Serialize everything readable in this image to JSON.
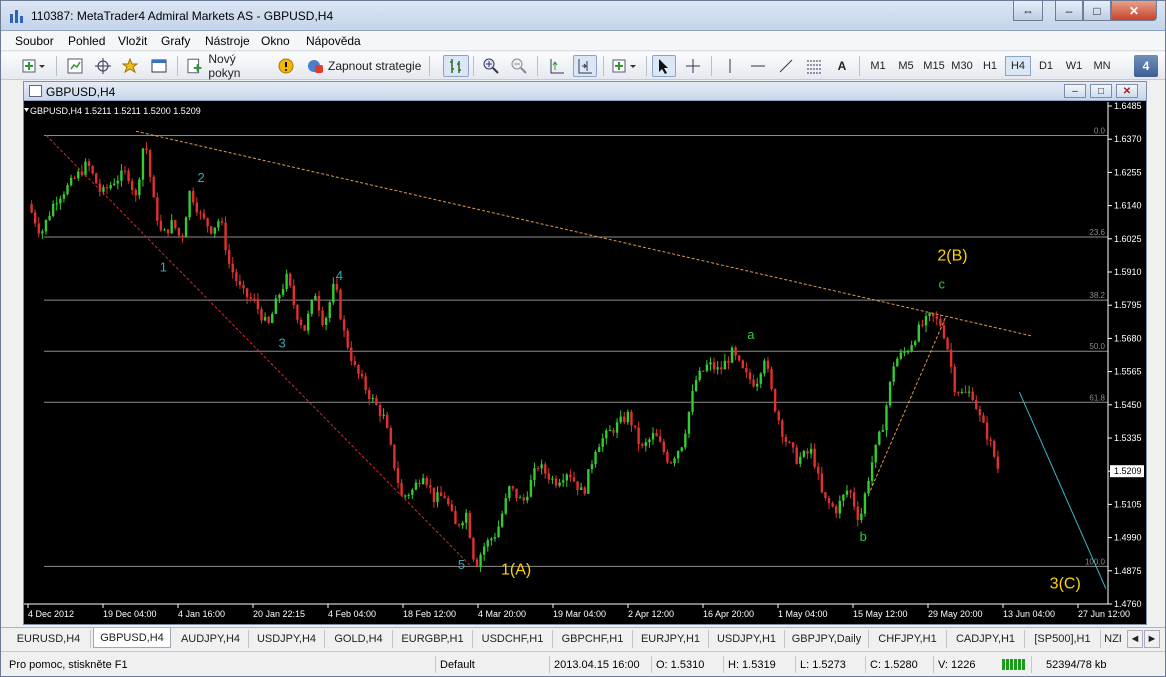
{
  "window": {
    "title": "110387: MetaTrader4 Admiral Markets AS - GBPUSD,H4",
    "buttons": {
      "restore": "⇔",
      "minimize": "–",
      "maximize": "□",
      "close": "✕"
    }
  },
  "menu": [
    "Soubor",
    "Pohled",
    "Vložit",
    "Grafy",
    "Nástroje",
    "Okno",
    "Nápověda"
  ],
  "toolbar": {
    "new_order_label": "Nový pokyn",
    "strategy_label": "Zapnout strategie",
    "text_tool_label": "A",
    "timeframes": [
      "M1",
      "M5",
      "M15",
      "M30",
      "H1",
      "H4",
      "D1",
      "W1",
      "MN"
    ],
    "active_timeframe": "H4",
    "window_count": "4"
  },
  "chart_window": {
    "title": "GBPUSD,H4",
    "header": "GBPUSD,H4  1.5211 1.5211 1.5200 1.5209"
  },
  "chart_data": {
    "type": "candlestick",
    "symbol": "GBPUSD",
    "timeframe": "H4",
    "ohlc_readout": [
      1.5211,
      1.5211,
      1.52,
      1.5209
    ],
    "current_price": "1.5209",
    "ylim": [
      1.471,
      1.6485
    ],
    "y_ticks": [
      "1.6485",
      "1.6370",
      "1.6255",
      "1.6140",
      "1.6025",
      "1.5910",
      "1.5795",
      "1.5680",
      "1.5565",
      "1.5450",
      "1.5335",
      "1.5209",
      "1.5105",
      "1.4990",
      "1.4875",
      "1.4760"
    ],
    "x_ticks": [
      "4 Dec 2012",
      "19 Dec 04:00",
      "4 Jan 16:00",
      "20 Jan 22:15",
      "4 Feb 04:00",
      "18 Feb 12:00",
      "4 Mar 20:00",
      "19 Mar 04:00",
      "2 Apr 12:00",
      "16 Apr 20:00",
      "1 May 04:00",
      "15 May 12:00",
      "29 May 20:00",
      "13 Jun 04:00",
      "27 Jun 12:00"
    ],
    "fibonacci": [
      {
        "label": "0.0",
        "price": 1.638
      },
      {
        "label": "23.6",
        "price": 1.6018
      },
      {
        "label": "38.2",
        "price": 1.5793
      },
      {
        "label": "50.0",
        "price": 1.5611
      },
      {
        "label": "61.8",
        "price": 1.5429
      },
      {
        "label": "100.0",
        "price": 1.4844
      }
    ],
    "price_path": [
      [
        0,
        1.6135
      ],
      [
        0.012,
        1.603
      ],
      [
        0.025,
        1.615
      ],
      [
        0.04,
        1.621
      ],
      [
        0.055,
        1.628
      ],
      [
        0.068,
        1.617
      ],
      [
        0.08,
        1.622
      ],
      [
        0.092,
        1.625
      ],
      [
        0.1,
        1.6155
      ],
      [
        0.108,
        1.638
      ],
      [
        0.116,
        1.615
      ],
      [
        0.124,
        1.602
      ],
      [
        0.134,
        1.607
      ],
      [
        0.142,
        1.6005
      ],
      [
        0.15,
        1.6185
      ],
      [
        0.16,
        1.609
      ],
      [
        0.17,
        1.6045
      ],
      [
        0.178,
        1.6085
      ],
      [
        0.186,
        1.5925
      ],
      [
        0.198,
        1.582
      ],
      [
        0.21,
        1.5785
      ],
      [
        0.222,
        1.5695
      ],
      [
        0.232,
        1.581
      ],
      [
        0.24,
        1.5875
      ],
      [
        0.248,
        1.575
      ],
      [
        0.256,
        1.569
      ],
      [
        0.266,
        1.582
      ],
      [
        0.274,
        1.5705
      ],
      [
        0.284,
        1.5855
      ],
      [
        0.292,
        1.5685
      ],
      [
        0.302,
        1.5555
      ],
      [
        0.316,
        1.5455
      ],
      [
        0.33,
        1.537
      ],
      [
        0.338,
        1.5225
      ],
      [
        0.346,
        1.509
      ],
      [
        0.356,
        1.5115
      ],
      [
        0.366,
        1.518
      ],
      [
        0.376,
        1.5085
      ],
      [
        0.386,
        1.5095
      ],
      [
        0.396,
        1.4985
      ],
      [
        0.406,
        1.5035
      ],
      [
        0.414,
        1.4845
      ],
      [
        0.422,
        1.4915
      ],
      [
        0.434,
        1.4965
      ],
      [
        0.446,
        1.5125
      ],
      [
        0.458,
        1.507
      ],
      [
        0.472,
        1.5205
      ],
      [
        0.488,
        1.5145
      ],
      [
        0.5,
        1.5185
      ],
      [
        0.514,
        1.51
      ],
      [
        0.526,
        1.5275
      ],
      [
        0.542,
        1.5335
      ],
      [
        0.556,
        1.5385
      ],
      [
        0.568,
        1.526
      ],
      [
        0.58,
        1.5315
      ],
      [
        0.594,
        1.5215
      ],
      [
        0.606,
        1.5285
      ],
      [
        0.618,
        1.5505
      ],
      [
        0.63,
        1.5565
      ],
      [
        0.64,
        1.554
      ],
      [
        0.652,
        1.5605
      ],
      [
        0.664,
        1.5525
      ],
      [
        0.674,
        1.5495
      ],
      [
        0.682,
        1.5595
      ],
      [
        0.69,
        1.5435
      ],
      [
        0.7,
        1.5305
      ],
      [
        0.712,
        1.5225
      ],
      [
        0.726,
        1.5255
      ],
      [
        0.736,
        1.5085
      ],
      [
        0.748,
        1.5045
      ],
      [
        0.76,
        1.5125
      ],
      [
        0.77,
        1.5005
      ],
      [
        0.78,
        1.5195
      ],
      [
        0.792,
        1.5355
      ],
      [
        0.802,
        1.5575
      ],
      [
        0.814,
        1.5615
      ],
      [
        0.826,
        1.5695
      ],
      [
        0.836,
        1.5735
      ],
      [
        0.846,
        1.5705
      ],
      [
        0.852,
        1.5615
      ],
      [
        0.858,
        1.5485
      ],
      [
        0.866,
        1.5455
      ],
      [
        0.874,
        1.5465
      ],
      [
        0.882,
        1.5365
      ],
      [
        0.89,
        1.5295
      ],
      [
        0.898,
        1.5195
      ]
    ],
    "wave_labels": [
      {
        "text": "1",
        "x": 0.122,
        "price": 1.5895,
        "color": "#3aa9b5"
      },
      {
        "text": "2",
        "x": 0.157,
        "price": 1.6215,
        "color": "#3aa9b5"
      },
      {
        "text": "3",
        "x": 0.232,
        "price": 1.5625,
        "color": "#3aa9b5"
      },
      {
        "text": "4",
        "x": 0.285,
        "price": 1.5865,
        "color": "#3aa9b5"
      },
      {
        "text": "5",
        "x": 0.398,
        "price": 1.4835,
        "color": "#3aa9b5"
      },
      {
        "text": "1(A)",
        "x": 0.438,
        "price": 1.4815,
        "color": "#ffd200"
      },
      {
        "text": "a",
        "x": 0.666,
        "price": 1.5655,
        "color": "#33cc33"
      },
      {
        "text": "b",
        "x": 0.77,
        "price": 1.4935,
        "color": "#33cc33"
      },
      {
        "text": "c",
        "x": 0.843,
        "price": 1.5835,
        "color": "#33cc33"
      },
      {
        "text": "2(B)",
        "x": 0.842,
        "price": 1.5935,
        "color": "#ffd200"
      },
      {
        "text": "3(C)",
        "x": 0.946,
        "price": 1.4765,
        "color": "#ffd200"
      }
    ],
    "trendlines": [
      {
        "from": [
          0.017,
          1.638
        ],
        "to": [
          0.41,
          1.4845
        ],
        "color": "#d02a2a",
        "dash": true
      },
      {
        "from": [
          0.1,
          1.6395
        ],
        "to": [
          0.93,
          1.5665
        ],
        "color": "#e09a4a",
        "dash": true
      },
      {
        "from": [
          0.78,
          1.5115
        ],
        "to": [
          0.85,
          1.5735
        ],
        "color": "#e09a4a",
        "dash": true
      },
      {
        "from": [
          0.918,
          1.5465
        ],
        "to": [
          0.998,
          1.4765
        ],
        "color": "#3ab8c8",
        "dash": false
      }
    ],
    "grid": false,
    "background": "#000000"
  },
  "symbol_tabs": [
    "EURUSD,H4",
    "GBPUSD,H4",
    "AUDJPY,H4",
    "USDJPY,H4",
    "GOLD,H4",
    "EURGBP,H1",
    "USDCHF,H1",
    "GBPCHF,H1",
    "EURJPY,H1",
    "USDJPY,H1",
    "GBPJPY,Daily",
    "CHFJPY,H1",
    "CADJPY,H1",
    "[SP500],H1",
    "NZI"
  ],
  "active_tab": "GBPUSD,H4",
  "tab_scroll": {
    "left": "◄",
    "right": "►"
  },
  "status": {
    "help": "Pro pomoc, stiskněte F1",
    "profile": "Default",
    "datetime": "2013.04.15 16:00",
    "open": "O: 1.5310",
    "high": "H: 1.5319",
    "low": "L: 1.5273",
    "close": "C: 1.5280",
    "volume": "V: 1226",
    "traffic": "52394/78 kb"
  },
  "colors": {
    "bull": "#33cc33",
    "bear": "#e03030",
    "fib_line": "#8c8c8c",
    "axis_text": "#ffffff",
    "title_bar": "#c4d4e9"
  }
}
